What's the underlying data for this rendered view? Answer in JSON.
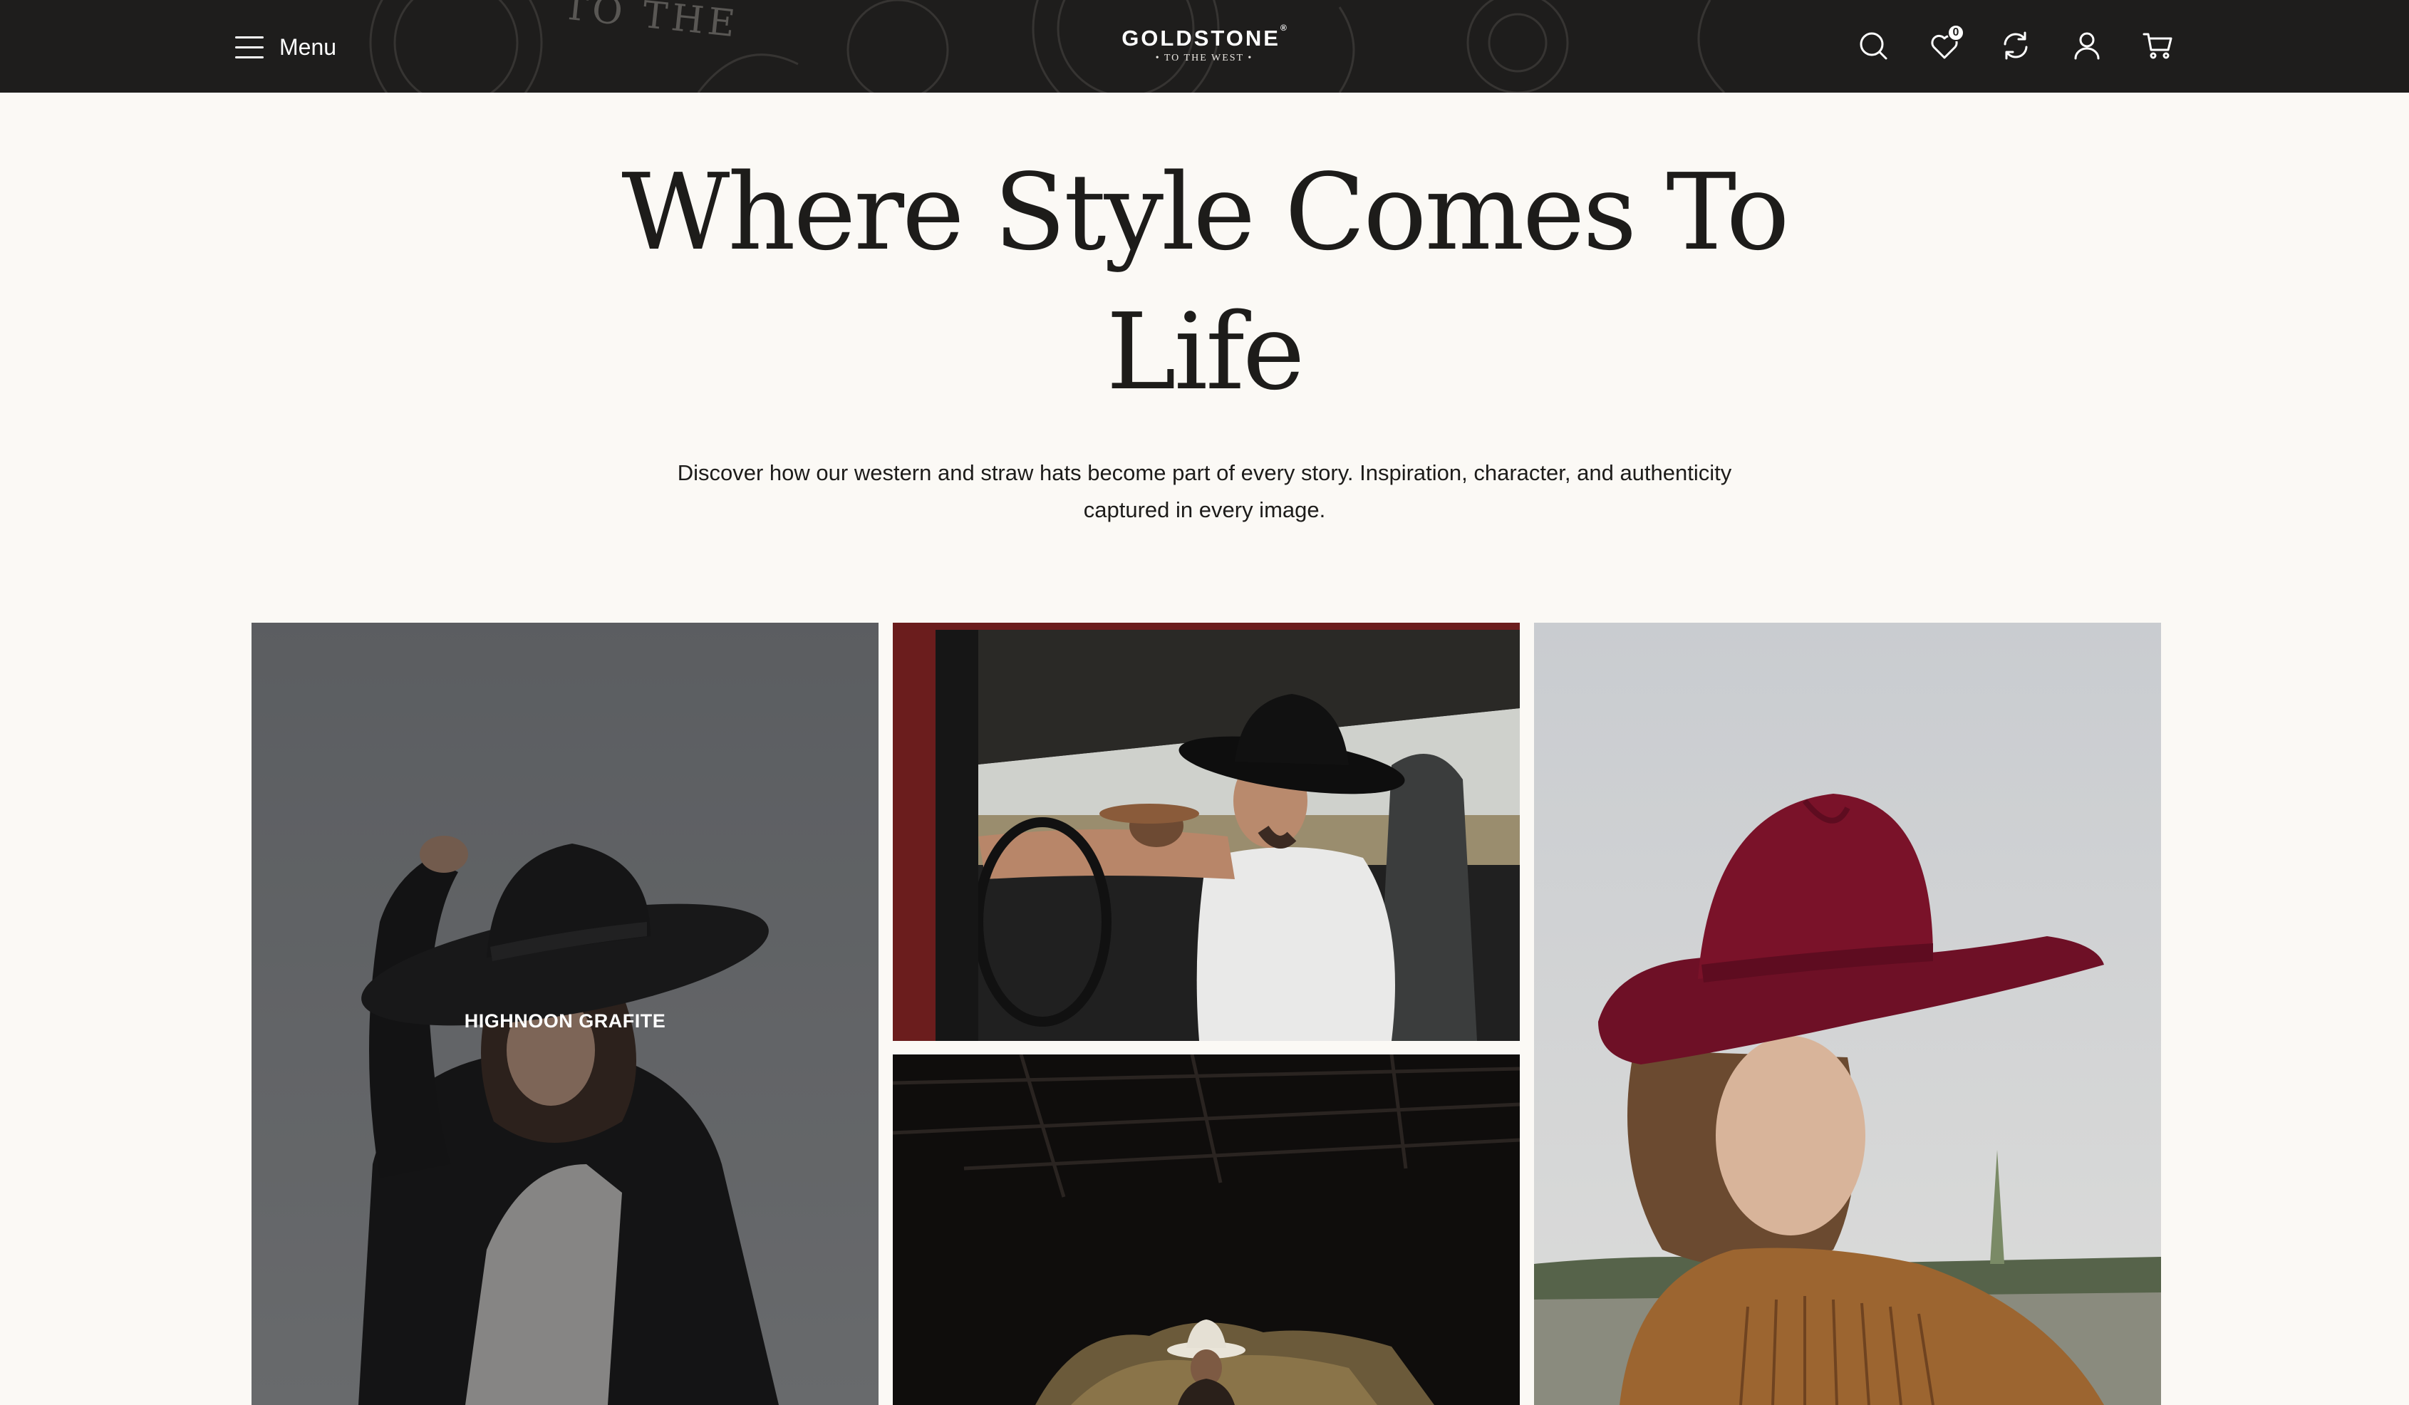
{
  "header": {
    "menu_label": "Menu",
    "brand": "GOLDSTONE",
    "brand_mark": "®",
    "tagline": "• TO THE WEST •",
    "background_lettering": "TO THE",
    "wishlist_count": "0",
    "icons": [
      "search-icon",
      "wishlist-icon",
      "compare-icon",
      "account-icon",
      "cart-icon"
    ]
  },
  "hero": {
    "title_line1": "Where Style Comes To",
    "title_line2": "Life",
    "subtitle": "Discover how our western and straw hats become part of every story. Inspiration, character, and authenticity captured in every image."
  },
  "gallery": {
    "tiles": [
      {
        "caption": "HIGHNOON GRAFITE"
      }
    ]
  },
  "colors": {
    "header_bg": "#1e1d1c",
    "page_bg": "#fbf9f5",
    "text": "#1d1c1a"
  }
}
